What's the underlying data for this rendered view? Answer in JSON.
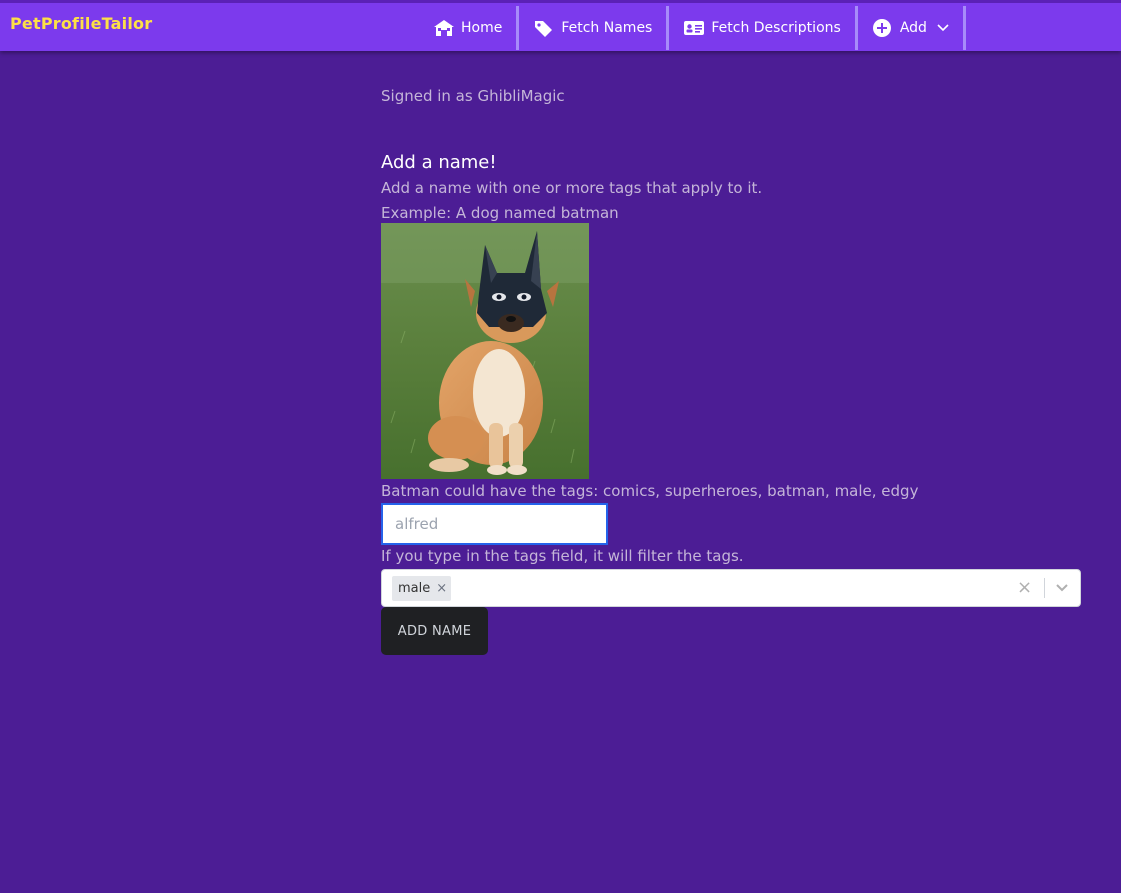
{
  "header": {
    "brand": "PetProfileTailor",
    "nav": [
      {
        "label": "Home",
        "icon": "house-icon"
      },
      {
        "label": "Fetch Names",
        "icon": "tag-icon"
      },
      {
        "label": "Fetch Descriptions",
        "icon": "id-card-icon"
      },
      {
        "label": "Add",
        "icon": "plus-circle-icon",
        "dropdown_icon": "chevron-down-icon"
      }
    ]
  },
  "main": {
    "signed_in": "Signed in as GhibliMagic",
    "heading": "Add a name!",
    "intro": "Add a name with one or more tags that apply to it.",
    "example": "Example: A dog named batman",
    "image_subject": "dog wearing a batman mask",
    "tags_hint": "Batman could have the tags: comics, superheroes, batman, male, edgy",
    "name_input_value": "alfred",
    "filter_hint": "If you type in the tags field, it will filter the tags.",
    "selected_tags": [
      "male"
    ],
    "chip_remove_glyph": "×",
    "clear_glyph": "×",
    "submit_label": "ADD NAME"
  },
  "colors": {
    "background": "#4c1d95",
    "navbar": "#7c3aed",
    "brand": "#fde047",
    "input_focus": "#2563eb",
    "button": "#1f2023"
  }
}
